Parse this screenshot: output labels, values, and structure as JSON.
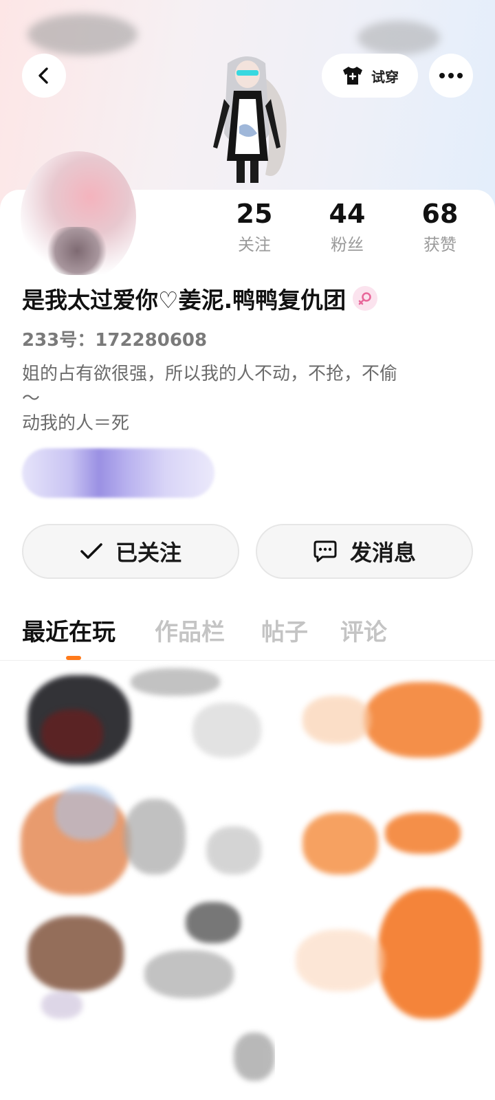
{
  "header": {
    "back_icon": "chevron-left-icon",
    "tryon_label": "试穿",
    "tryon_icon": "tshirt-icon",
    "more_icon": "more-dots-icon"
  },
  "stats": [
    {
      "value": "25",
      "label": "关注"
    },
    {
      "value": "44",
      "label": "粉丝"
    },
    {
      "value": "68",
      "label": "获赞"
    }
  ],
  "profile": {
    "nickname": "是我太过爱你♡姜泥.鸭鸭复仇团",
    "gender": "female",
    "uid": "233号：172280608",
    "bio": "姐的占有欲很强，所以我的人不动，不抢，不偷\n～\n动我的人＝死"
  },
  "actions": {
    "follow_label": "已关注",
    "message_label": "发消息"
  },
  "tabs": [
    {
      "label": "最近在玩",
      "active": true
    },
    {
      "label": "作品栏",
      "active": false
    },
    {
      "label": "帖子",
      "active": false
    },
    {
      "label": "评论",
      "active": false
    }
  ],
  "colors": {
    "accent": "#ff7a1a",
    "tab_inactive": "#c4c4c4",
    "gender_female": "#e8679a"
  }
}
